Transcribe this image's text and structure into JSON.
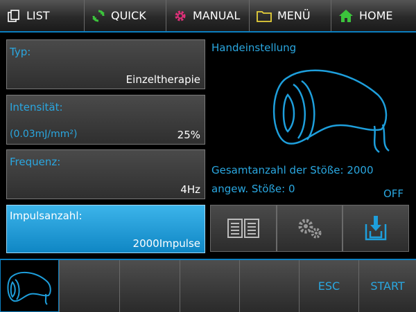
{
  "nav": {
    "list": "LIST",
    "quick": "QUICK",
    "manual": "MANUAL",
    "menu": "MENÜ",
    "home": "HOME"
  },
  "params": {
    "typ": {
      "label": "Typ:",
      "value": "Einzeltherapie"
    },
    "intensity": {
      "label": "Intensität:",
      "unit": "(0.03mJ/mm²)",
      "value": "25%"
    },
    "frequency": {
      "label": "Frequenz:",
      "value": "4Hz"
    },
    "impulses": {
      "label": "Impulsanzahl:",
      "value": "2000Impulse"
    }
  },
  "right": {
    "title": "Handeinstellung",
    "total_shocks": "Gesamtanzahl der Stöße: 2000",
    "applied_shocks": "angew. Stöße: 0",
    "status": "OFF"
  },
  "bottom": {
    "esc": "ESC",
    "start": "START"
  },
  "icons": {
    "list": "list-icon",
    "quick": "refresh-icon",
    "manual": "gear-icon",
    "menu": "folder-icon",
    "home": "home-icon",
    "book": "book-icon",
    "settings": "gears-icon",
    "download": "download-icon",
    "handpiece": "handpiece-icon"
  },
  "colors": {
    "accent": "#2aa7e0",
    "active": "#1e9fdc",
    "manual_icon": "#e0307a",
    "quick_icon": "#3cc43c"
  }
}
